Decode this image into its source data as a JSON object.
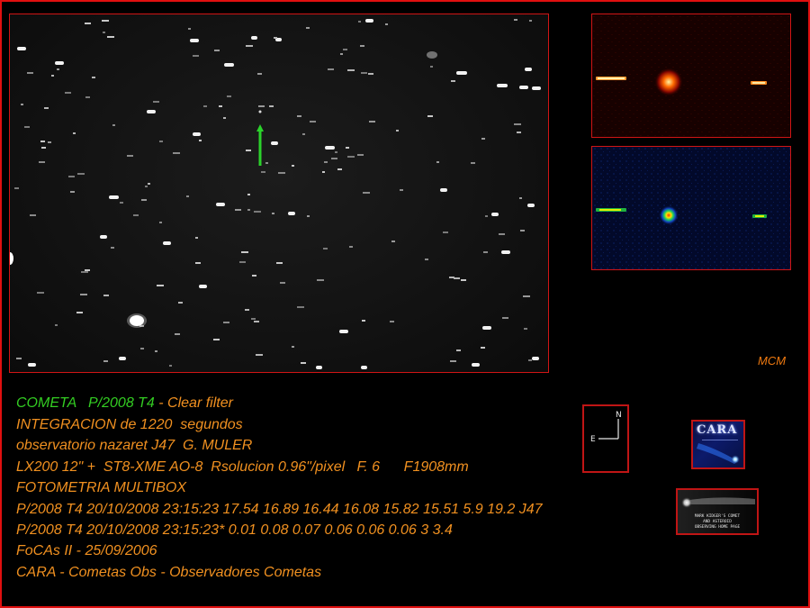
{
  "image": {
    "comet_marker_color": "#2bd22b",
    "frame_color": "#e01010",
    "caption_color": "#f09020",
    "title_color": "#33cc22"
  },
  "badge": {
    "text": "MCM"
  },
  "compass": {
    "north": "N",
    "east": "E"
  },
  "cara_logo": {
    "text": "CARA"
  },
  "mark_kidger": {
    "line1": "MARK KIDGER'S COMET",
    "line2": "AND ASTEROID",
    "line3": "OBSERVING HOME PAGE"
  },
  "caption": {
    "comet_label": "COMETA   ",
    "comet_name": "P/2008 T4",
    "comet_filter": " - Clear filter",
    "line2": "INTEGRACION de 1220  segundos",
    "line3": "observatorio nazaret J47  G. MULER",
    "line4": "LX200 12\" +  ST8-XME AO-8  Rsolucion 0.96\"/pixel   F. 6      F1908mm",
    "line5": "FOTOMETRIA MULTIBOX",
    "line6": "P/2008 T4 20/10/2008 23:15:23 17.54 16.89 16.44 16.08 15.82 15.51 5.9 19.2 J47",
    "line7": "P/2008 T4 20/10/2008 23:15:23* 0.01 0.08 0.07 0.06 0.06 0.06 3 3.4",
    "line8": "FoCAs II - 25/09/2006",
    "line9": "CARA - Cometas Obs - Observadores Cometas"
  }
}
